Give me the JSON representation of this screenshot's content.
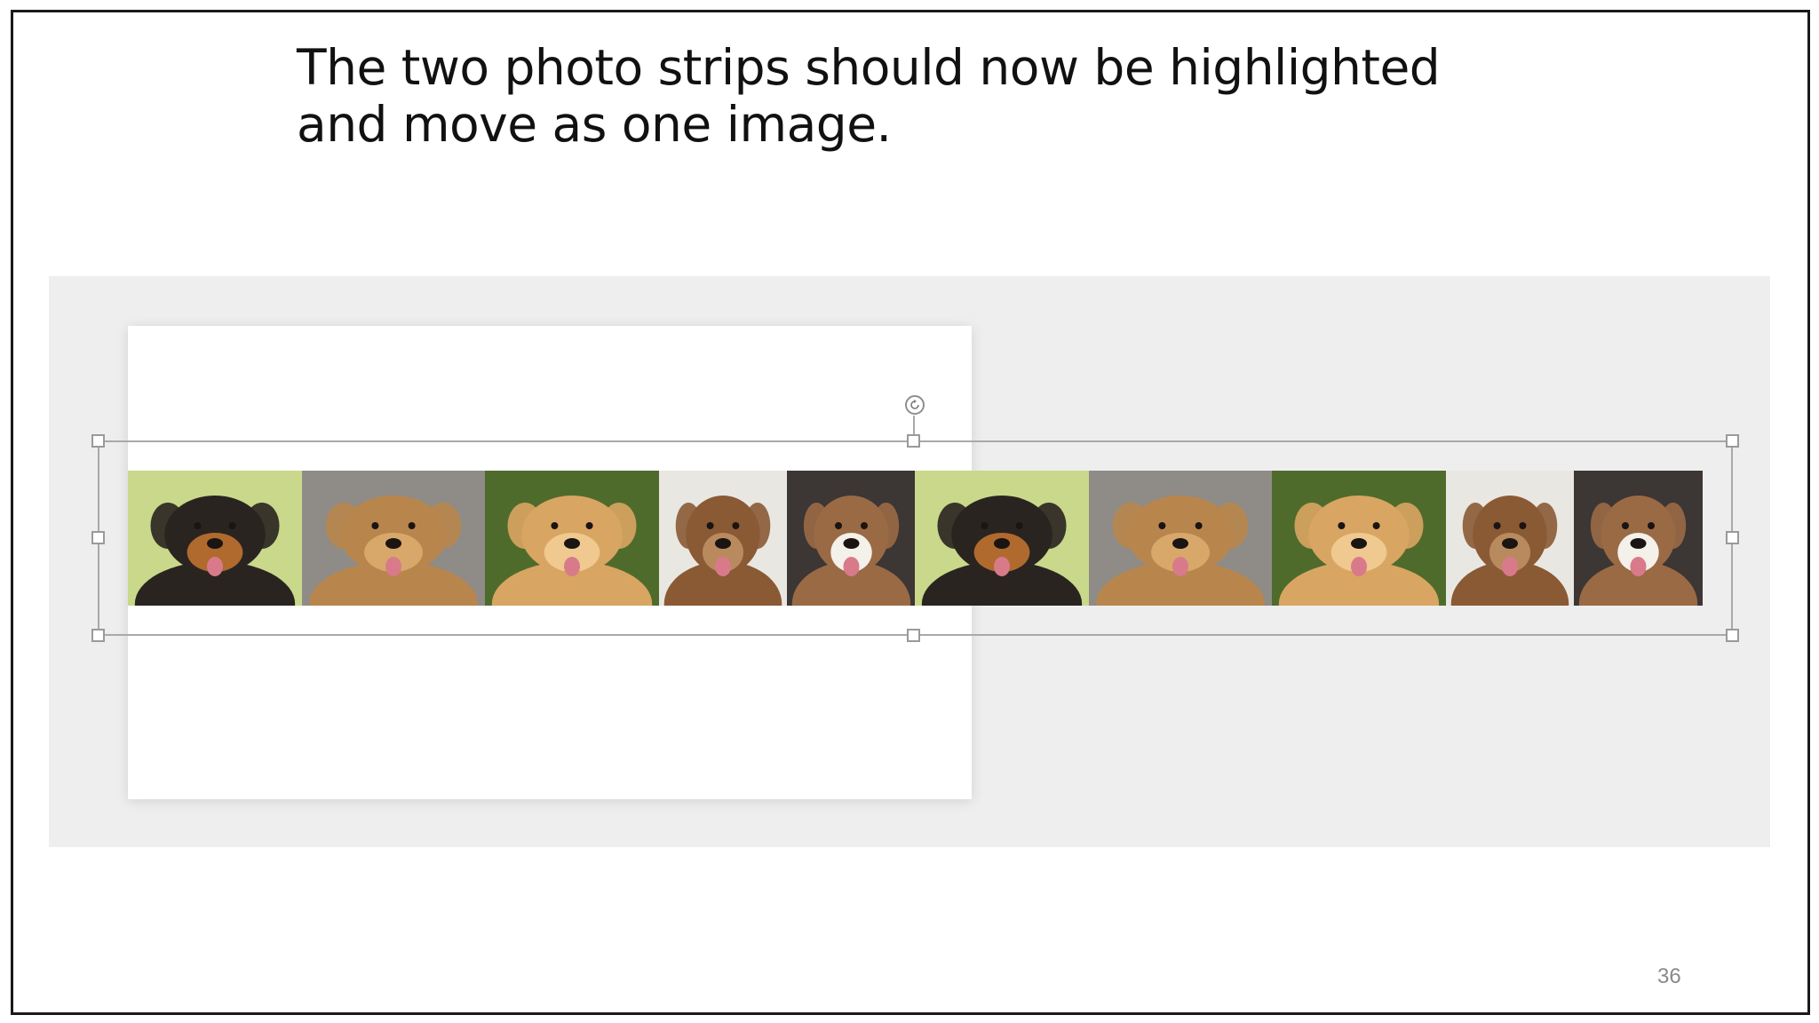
{
  "caption": "The two photo strips should now be highlighted and move as one image.",
  "page_number": "36",
  "photo_strips": [
    {
      "photos": [
        {
          "name": "rottweiler-photo",
          "bg": "#c9d88a",
          "coat": "#2a2420",
          "accent": "#b06a2e"
        },
        {
          "name": "golden-retriever-photo-gray",
          "bg": "#8f8b86",
          "coat": "#b8864d",
          "accent": "#d7a86a"
        },
        {
          "name": "golden-retriever-photo-green",
          "bg": "#4f6b2c",
          "coat": "#d9a562",
          "accent": "#efc98f"
        },
        {
          "name": "cockapoo-photo",
          "bg": "#e9e7e1",
          "coat": "#8a5a35",
          "accent": "#b88a5d"
        },
        {
          "name": "terrier-mix-photo",
          "bg": "#3c3634",
          "coat": "#9a6a45",
          "accent": "#f4f0ea"
        }
      ]
    },
    {
      "photos": [
        {
          "name": "rottweiler-photo",
          "bg": "#c9d88a",
          "coat": "#2a2420",
          "accent": "#b06a2e"
        },
        {
          "name": "golden-retriever-photo-gray",
          "bg": "#8f8b86",
          "coat": "#b8864d",
          "accent": "#d7a86a"
        },
        {
          "name": "golden-retriever-photo-green",
          "bg": "#4f6b2c",
          "coat": "#d9a562",
          "accent": "#efc98f"
        },
        {
          "name": "cockapoo-photo",
          "bg": "#e9e7e1",
          "coat": "#8a5a35",
          "accent": "#b88a5d"
        },
        {
          "name": "terrier-mix-photo",
          "bg": "#3c3634",
          "coat": "#9a6a45",
          "accent": "#f4f0ea"
        }
      ]
    }
  ],
  "colors": {
    "selection_border": "#a9a9a9",
    "canvas_background": "#efeeee",
    "slide_background": "#ffffff"
  }
}
